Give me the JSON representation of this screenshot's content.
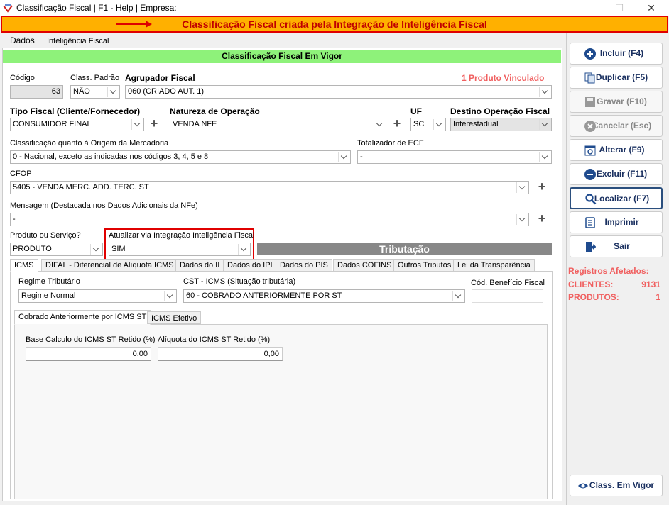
{
  "window": {
    "title": "Classificação Fiscal | F1 - Help | Empresa:",
    "minimize": "—",
    "maximize": "☐",
    "close": "✕"
  },
  "banner": {
    "text": "Classificação Fiscal criada pela Integração de Inteligência Fiscal"
  },
  "tabs": {
    "dados": "Dados",
    "inteligencia": "Inteligência Fiscal"
  },
  "header": {
    "status": "Classificação Fiscal Em Vigor"
  },
  "form": {
    "codigo_label": "Código",
    "codigo_value": "63",
    "class_padrao_label": "Class. Padrão",
    "class_padrao_value": "NÃO",
    "agrupador_label": "Agrupador Fiscal",
    "agrupador_value": "060 (CRIADO AUT. 1)",
    "produto_vinculado": "1 Produto Vinculado",
    "tipo_fiscal_label": "Tipo Fiscal (Cliente/Fornecedor)",
    "tipo_fiscal_value": "CONSUMIDOR FINAL",
    "natureza_label": "Natureza de Operação",
    "natureza_value": "VENDA NFE",
    "uf_label": "UF",
    "uf_value": "SC",
    "destino_label": "Destino Operação Fiscal",
    "destino_value": "Interestadual",
    "origem_label": "Classificação quanto à Origem da Mercadoria",
    "origem_value": "0 - Nacional, exceto as indicadas nos códigos 3, 4, 5 e 8",
    "totalizador_label": "Totalizador de ECF",
    "totalizador_value": "-",
    "cfop_label": "CFOP",
    "cfop_value": "5405 - VENDA MERC. ADD. TERC. ST",
    "mensagem_label": "Mensagem (Destacada nos Dados Adicionais da NFe)",
    "mensagem_value": "-",
    "produto_servico_label": "Produto ou Serviço?",
    "produto_servico_value": "PRODUTO",
    "atualizar_label": "Atualizar via Integração Inteligência Fiscal",
    "atualizar_value": "SIM",
    "plus": "+"
  },
  "tributacao": {
    "title": "Tributação",
    "tabs": [
      "ICMS",
      "DIFAL - Diferencial de Alíquota ICMS",
      "Dados do II",
      "Dados do IPI",
      "Dados do PIS",
      "Dados COFINS",
      "Outros Tributos",
      "Lei da Transparência"
    ],
    "regime_label": "Regime Tributário",
    "regime_value": "Regime Normal",
    "cst_label": "CST - ICMS (Situação tributária)",
    "cst_value": "60 - COBRADO ANTERIORMENTE POR ST",
    "beneficio_label": "Cód. Benefício Fiscal",
    "beneficio_value": "",
    "inner_tabs": [
      "Cobrado Anteriormente por ICMS ST",
      "ICMS Efetivo"
    ],
    "base_label": "Base Calculo do ICMS ST Retido (%)",
    "base_value": "0,00",
    "aliquota_label": "Alíquota do ICMS ST Retido (%)",
    "aliquota_value": "0,00"
  },
  "sidebar": {
    "buttons": {
      "incluir": "Incluir (F4)",
      "duplicar": "Duplicar (F5)",
      "gravar": "Gravar (F10)",
      "cancelar": "Cancelar (Esc)",
      "alterar": "Alterar (F9)",
      "excluir": "Excluir (F11)",
      "localizar": "Localizar (F7)",
      "imprimir": "Imprimir",
      "sair": "Sair",
      "vigor": "Class. Em Vigor"
    },
    "registros_title": "Registros Afetados:",
    "clientes_label": "CLIENTES:",
    "clientes_value": "9131",
    "produtos_label": "PRODUTOS:",
    "produtos_value": "1"
  },
  "colors": {
    "banner_bg": "#ffb000",
    "banner_border": "#e00000",
    "green": "#8ef27a",
    "accent": "#1a3060"
  }
}
